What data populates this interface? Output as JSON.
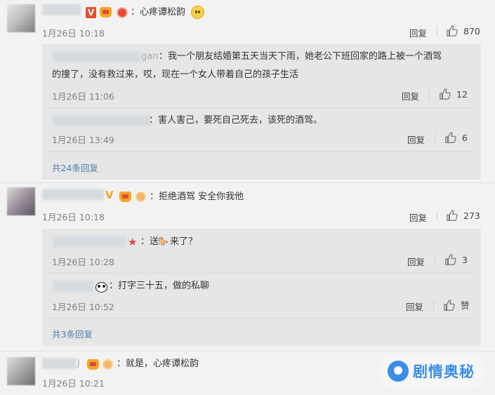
{
  "ui": {
    "reply_label": "回复",
    "like_icon": "thumbs-up-icon"
  },
  "comments": [
    {
      "text": "：心疼谭松韵",
      "time": "1月26日 10:18",
      "likes": "870",
      "subs": [
        {
          "name_suffix": "gan",
          "text_line1": "：我一个朋友结婚第五天当天下雨，她老公下班回家的路上被一个酒驾",
          "text_line2": "的撞了，没有救过来，哎，现在一个女人带着自己的孩子生活",
          "time": "1月26日 11:06",
          "likes": "12"
        },
        {
          "text": "：害人害己，要死自己死去，该死的酒驾。",
          "time": "1月26日 13:49",
          "likes": "6"
        }
      ],
      "more": "共24条回复"
    },
    {
      "text": "：拒绝酒驾 安全你我他",
      "time": "1月26日 10:18",
      "likes": "273",
      "subs": [
        {
          "text_a": "：送",
          "text_b": "来了？",
          "time": "1月26日 10:28",
          "likes": "3"
        },
        {
          "text": "：打字三十五，做的私聊",
          "time": "1月26日 10:52",
          "likes": "赞"
        }
      ],
      "more": "共3条回复"
    },
    {
      "name_suffix": "j",
      "text": "：就是，心疼谭松韵",
      "time": "1月26日 10:21"
    }
  ],
  "watermark": {
    "text": "剧情奥秘"
  }
}
